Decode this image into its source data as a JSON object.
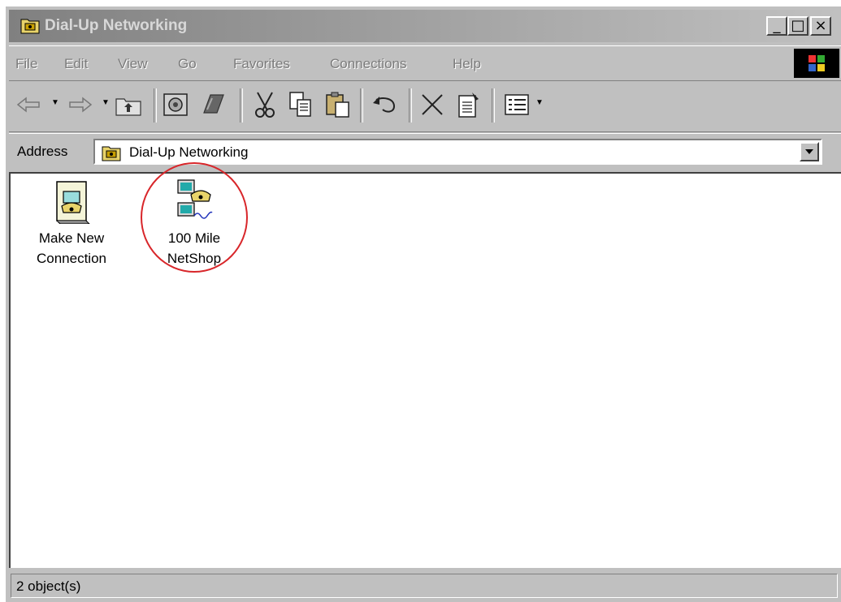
{
  "window": {
    "title": "Dial-Up Networking",
    "minimize_label": "_",
    "maximize_label": "□",
    "close_label": "×"
  },
  "menu": {
    "items": [
      {
        "label": "File"
      },
      {
        "label": "Edit"
      },
      {
        "label": "View"
      },
      {
        "label": "Go"
      },
      {
        "label": "Favorites"
      },
      {
        "label": "Connections"
      },
      {
        "label": "Help"
      }
    ]
  },
  "toolbar": {
    "buttons": [
      "back-icon",
      "forward-icon",
      "up-folder-icon",
      "map-drive-icon",
      "disconnect-drive-icon",
      "cut-icon",
      "copy-icon",
      "paste-icon",
      "undo-icon",
      "delete-icon",
      "properties-icon",
      "views-icon"
    ]
  },
  "address": {
    "label": "Address",
    "value": "Dial-Up Networking"
  },
  "items": [
    {
      "label_line1": "Make New",
      "label_line2": "Connection",
      "icon": "make-new-connection-icon"
    },
    {
      "label_line1": "100 Mile",
      "label_line2": "NetShop",
      "icon": "dialup-connection-icon"
    }
  ],
  "annotation": {
    "color": "#d8262a"
  },
  "status": {
    "text": "2 object(s)"
  }
}
